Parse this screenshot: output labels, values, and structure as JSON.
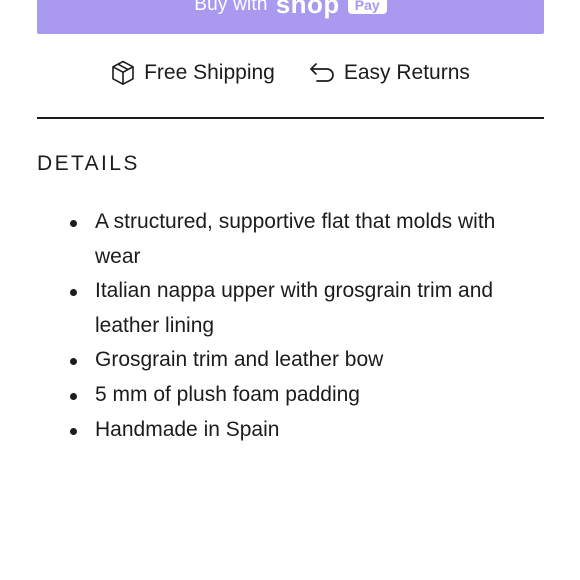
{
  "shop_pay": {
    "buy_with": "Buy with",
    "shop": "shop",
    "pay": "Pay"
  },
  "perks": {
    "shipping": "Free Shipping",
    "returns": "Easy Returns"
  },
  "details": {
    "title": "DETAILS",
    "items": [
      "A structured, supportive flat that molds with wear",
      "Italian nappa upper with grosgrain trim and leather lining",
      "Grosgrain trim and leather bow",
      "5 mm of plush foam padding",
      "Handmade in Spain"
    ]
  },
  "colors": {
    "shop_pay_purple": "#a99af0",
    "text": "#1c1c1c",
    "background": "#ffffff"
  },
  "icons": {
    "shipping": "box-icon",
    "returns": "return-arrow-icon"
  }
}
